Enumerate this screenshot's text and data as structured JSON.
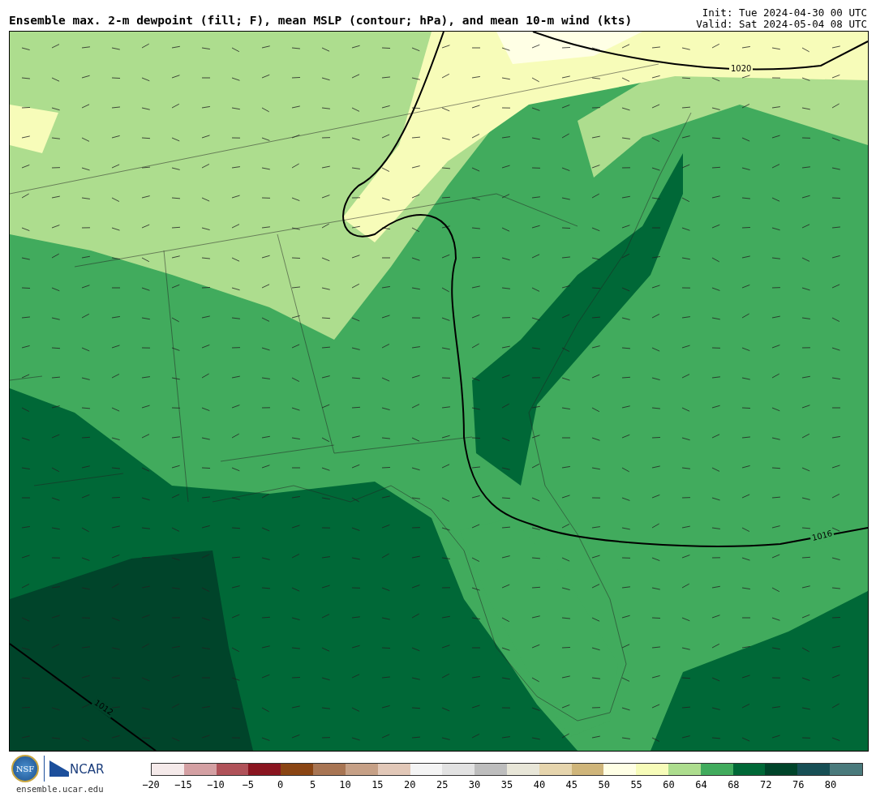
{
  "header": {
    "title": "Ensemble max. 2-m dewpoint (fill; F), mean MSLP (contour; hPa), and mean 10-m wind (kts)",
    "init": "Init: Tue 2024-04-30 00 UTC",
    "valid": "Valid: Sat 2024-05-04 08 UTC"
  },
  "map": {
    "contour_labels": [
      {
        "text": "1020",
        "kind": "flat"
      },
      {
        "text": "1016",
        "kind": "tilted"
      },
      {
        "text": "1012",
        "kind": "steep"
      }
    ]
  },
  "footer": {
    "nsf_logo": "NSF",
    "ncar_logo": "NCAR",
    "site": "ensemble.ucar.edu"
  },
  "colorbar": {
    "segments": [
      {
        "color": "#f5eaea"
      },
      {
        "color": "#d4a0a3"
      },
      {
        "color": "#b05259"
      },
      {
        "color": "#8a1520"
      },
      {
        "color": "#8a4513"
      },
      {
        "color": "#a87553"
      },
      {
        "color": "#c6a086"
      },
      {
        "color": "#e2c8b8"
      },
      {
        "color": "#f4f4f4"
      },
      {
        "color": "#e2e2e2"
      },
      {
        "color": "#bdbdbd"
      },
      {
        "color": "#e8e6d8"
      },
      {
        "color": "#e6d5ad"
      },
      {
        "color": "#cfb57a"
      },
      {
        "color": "#ffffe5"
      },
      {
        "color": "#f7fcb9"
      },
      {
        "color": "#addd8e"
      },
      {
        "color": "#41ab5d"
      },
      {
        "color": "#006837"
      },
      {
        "color": "#00442a"
      },
      {
        "color": "#174f55"
      },
      {
        "color": "#4a7a7c"
      }
    ],
    "ticks": [
      "−20",
      "−15",
      "−10",
      "−5",
      "0",
      "5",
      "10",
      "15",
      "20",
      "25",
      "30",
      "35",
      "40",
      "45",
      "50",
      "55",
      "60",
      "64",
      "68",
      "72",
      "76",
      "80"
    ]
  }
}
